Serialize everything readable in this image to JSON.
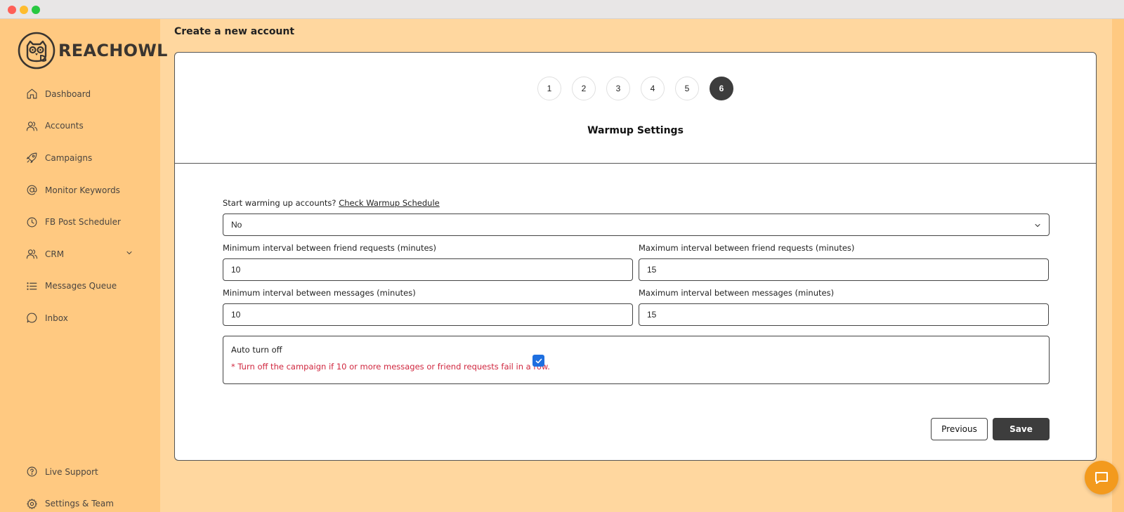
{
  "brand": {
    "name": "REACHOWL"
  },
  "sidebar": {
    "items": [
      {
        "label": "Dashboard",
        "icon": "home-icon"
      },
      {
        "label": "Accounts",
        "icon": "users-icon"
      },
      {
        "label": "Campaigns",
        "icon": "rocket-icon"
      },
      {
        "label": "Monitor Keywords",
        "icon": "at-sign-icon"
      },
      {
        "label": "FB Post Scheduler",
        "icon": "clock-icon"
      },
      {
        "label": "CRM",
        "icon": "users-icon"
      },
      {
        "label": "Messages Queue",
        "icon": "list-icon"
      },
      {
        "label": "Inbox",
        "icon": "chat-bubble-icon"
      }
    ],
    "bottom_items": [
      {
        "label": "Live Support",
        "icon": "help-circle-icon"
      },
      {
        "label": "Settings & Team",
        "icon": "gear-icon"
      }
    ]
  },
  "page": {
    "title": "Create a new account"
  },
  "stepper": {
    "steps": [
      "1",
      "2",
      "3",
      "4",
      "5",
      "6"
    ],
    "active": "6"
  },
  "section": {
    "title": "Warmup Settings"
  },
  "form": {
    "warmup_label": "Start warming up accounts?",
    "warmup_link": "Check Warmup Schedule",
    "warmup_value": "No",
    "min_friend_label": "Minimum interval between friend requests (minutes)",
    "min_friend_value": "10",
    "max_friend_label": "Maximum interval between friend requests (minutes)",
    "max_friend_value": "15",
    "min_msg_label": "Minimum interval between messages (minutes)",
    "min_msg_value": "10",
    "max_msg_label": "Maximum interval between messages (minutes)",
    "max_msg_value": "15",
    "auto_off_title": "Auto turn off",
    "auto_off_note": "* Turn off the campaign if 10 or more messages or friend requests fail in a row.",
    "auto_off_checked": true
  },
  "buttons": {
    "previous": "Previous",
    "save": "Save"
  },
  "colors": {
    "sidebar_bg": "#ffc981",
    "app_bg": "#ffd79f",
    "accent_dark": "#3d3d3d",
    "warning_text": "#d0273f",
    "checkbox_blue": "#1e6fe0",
    "chat_fab": "#f39a1d"
  }
}
